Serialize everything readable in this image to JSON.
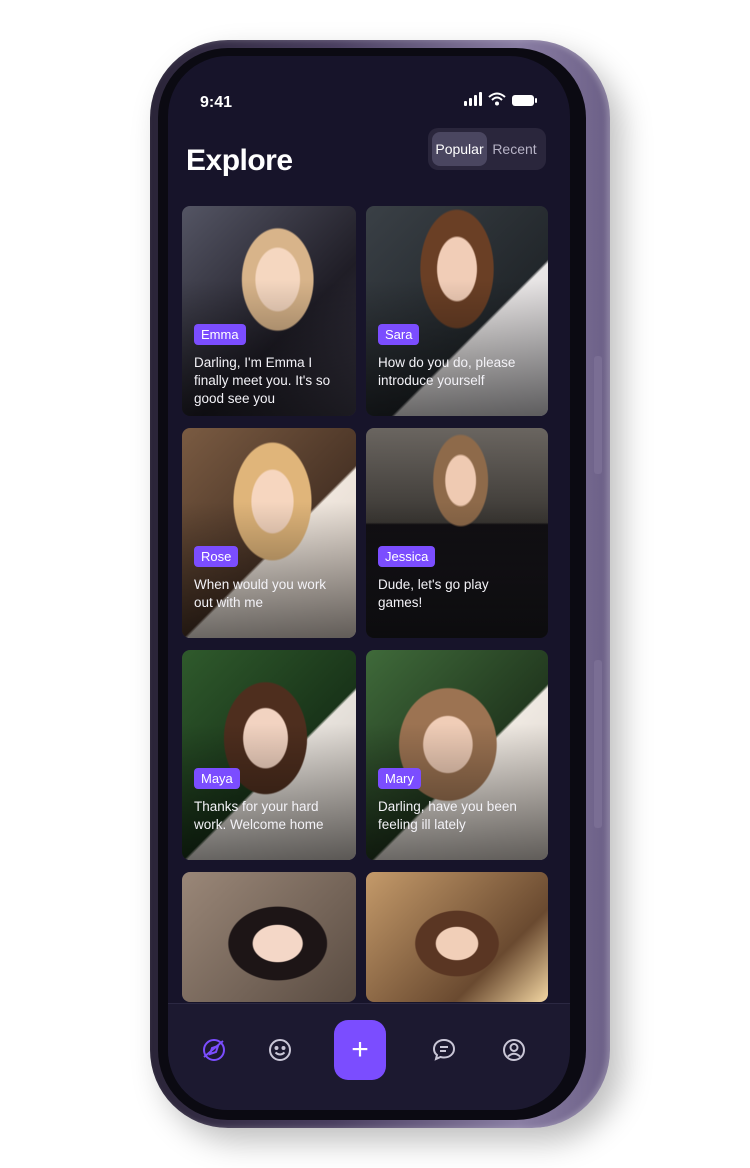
{
  "status": {
    "time": "9:41"
  },
  "header": {
    "title": "Explore",
    "tabs": [
      {
        "label": "Popular",
        "active": true
      },
      {
        "label": "Recent",
        "active": false
      }
    ]
  },
  "cards": [
    {
      "name": "Emma",
      "message": "Darling, I'm Emma I finally meet you. It's so good see you"
    },
    {
      "name": "Sara",
      "message": "How do you do, please introduce yourself"
    },
    {
      "name": "Rose",
      "message": "When would you work out with me"
    },
    {
      "name": "Jessica",
      "message": "Dude, let's go play games!"
    },
    {
      "name": "Maya",
      "message": "Thanks for your hard work. Welcome home"
    },
    {
      "name": "Mary",
      "message": "Darling, have you been feeling ill lately"
    },
    {
      "name": "",
      "message": ""
    },
    {
      "name": "",
      "message": ""
    }
  ],
  "tabbar": {
    "items": [
      {
        "icon": "explore-icon",
        "active": true
      },
      {
        "icon": "smile-icon",
        "active": false
      },
      {
        "icon": "plus-icon",
        "label": "+"
      },
      {
        "icon": "chat-icon",
        "active": false
      },
      {
        "icon": "profile-icon",
        "active": false
      }
    ]
  },
  "colors": {
    "accent": "#7b4dff",
    "background": "#17142a"
  }
}
